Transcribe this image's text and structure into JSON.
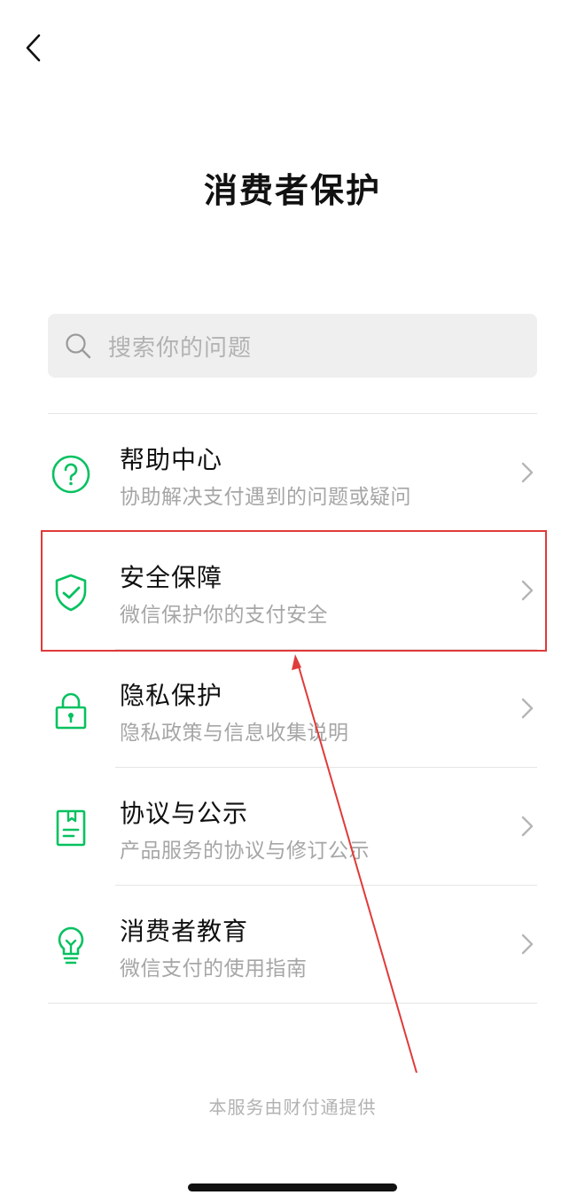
{
  "header": {
    "title": "消费者保护"
  },
  "search": {
    "placeholder": "搜索你的问题"
  },
  "menu": {
    "items": [
      {
        "icon": "question-circle-icon",
        "title": "帮助中心",
        "subtitle": "协助解决支付遇到的问题或疑问"
      },
      {
        "icon": "shield-check-icon",
        "title": "安全保障",
        "subtitle": "微信保护你的支付安全"
      },
      {
        "icon": "lock-icon",
        "title": "隐私保护",
        "subtitle": "隐私政策与信息收集说明"
      },
      {
        "icon": "document-icon",
        "title": "协议与公示",
        "subtitle": "产品服务的协议与修订公示"
      },
      {
        "icon": "lightbulb-icon",
        "title": "消费者教育",
        "subtitle": "微信支付的使用指南"
      }
    ]
  },
  "footer": {
    "text": "本服务由财付通提供"
  },
  "colors": {
    "accent": "#07c160",
    "annotation": "#e03a3a"
  }
}
